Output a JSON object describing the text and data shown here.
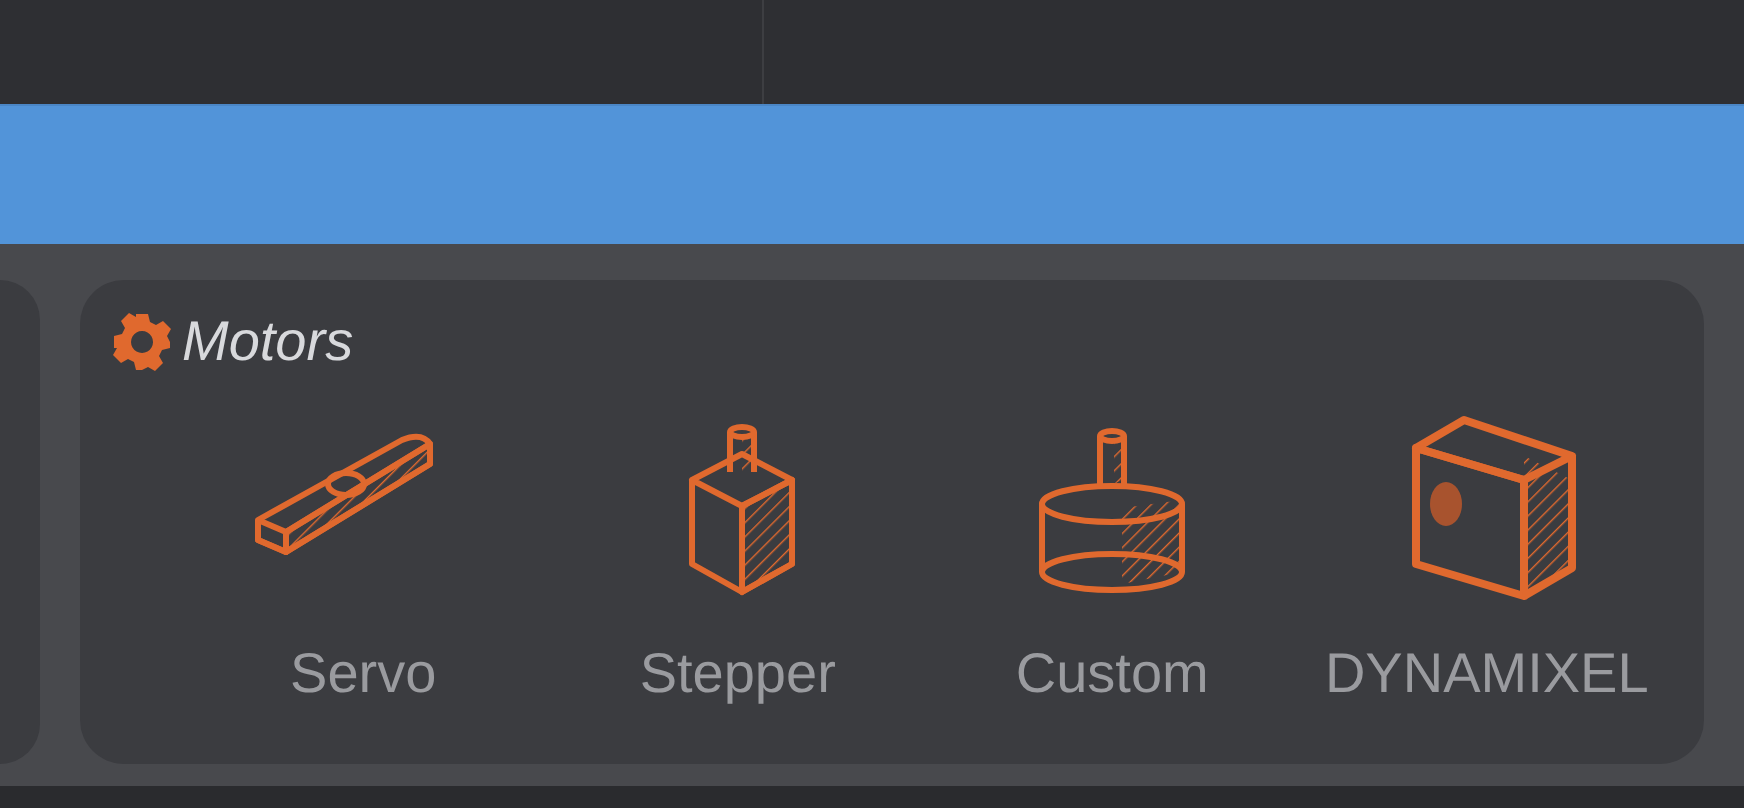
{
  "section": {
    "title": "Motors"
  },
  "motors": [
    {
      "kind": "servo",
      "label": "Servo"
    },
    {
      "kind": "stepper",
      "label": "Stepper"
    },
    {
      "kind": "custom",
      "label": "Custom"
    },
    {
      "kind": "dynamixel",
      "label": "DYNAMIXEL"
    }
  ]
}
